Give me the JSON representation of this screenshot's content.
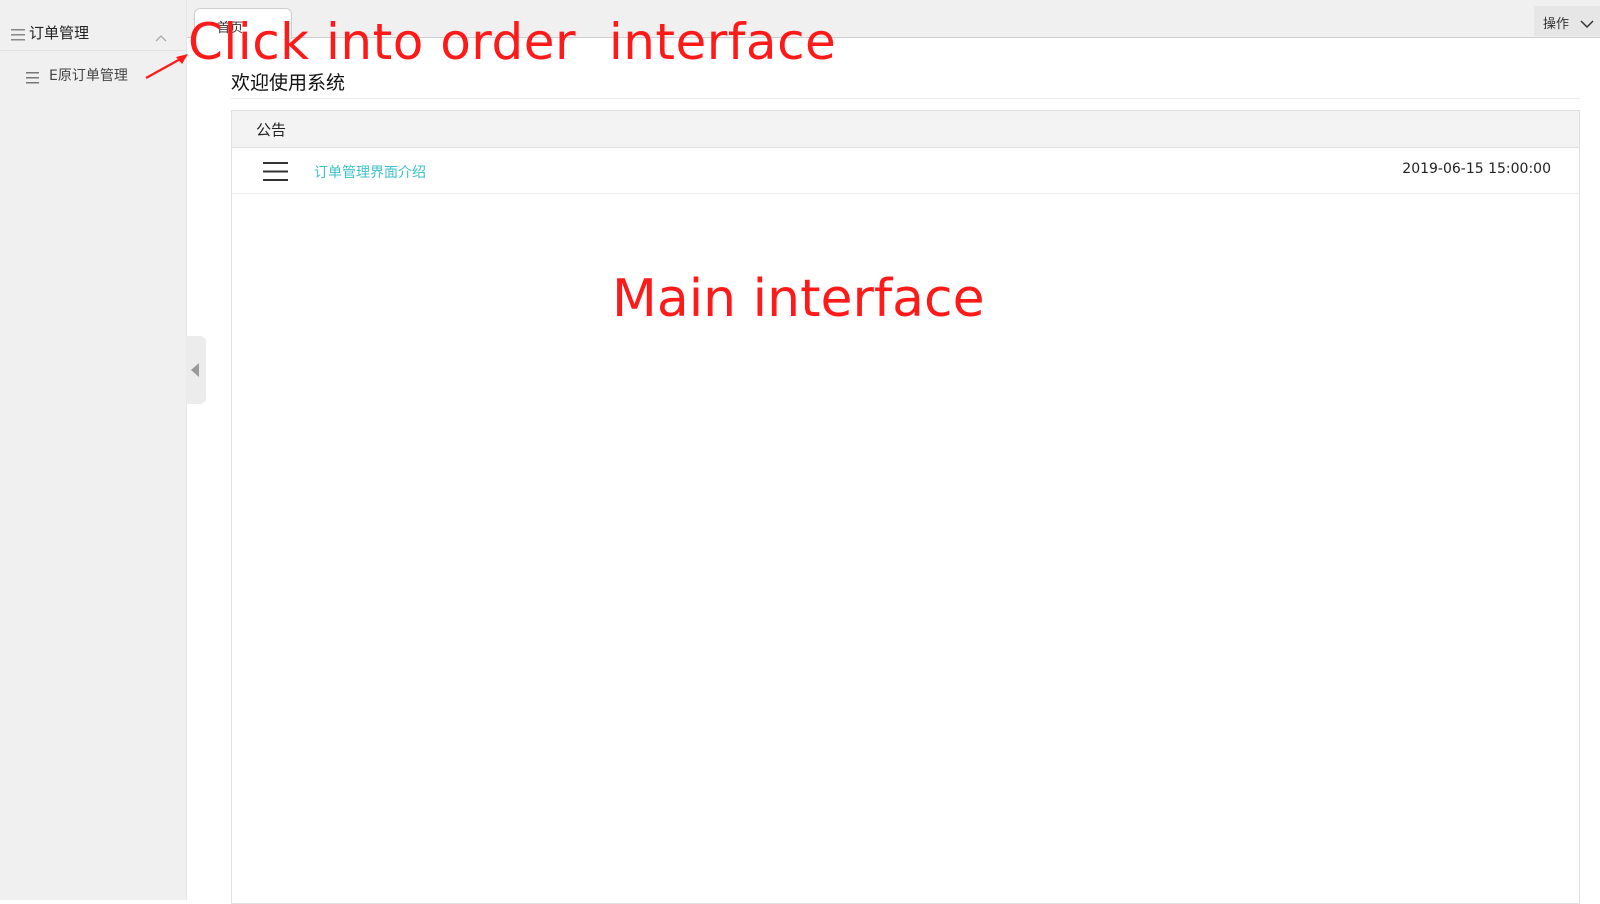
{
  "sidebar": {
    "menu_header": "订单管理",
    "items": [
      {
        "label": "E原订单管理"
      }
    ]
  },
  "tabs": [
    {
      "label": "首页"
    }
  ],
  "toolbar": {
    "ops_label": "操作"
  },
  "main": {
    "welcome": "欢迎使用系统",
    "notice": {
      "header": "公告",
      "items": [
        {
          "title": "订单管理界面介绍",
          "date": "2019-06-15 15:00:00"
        }
      ]
    }
  },
  "annotations": {
    "top": "Click into order  interface",
    "main": "Main interface",
    "color": "#ff1a1a"
  },
  "colors": {
    "link": "#3fc2c8",
    "sidebar_bg": "#f0f0f0"
  }
}
